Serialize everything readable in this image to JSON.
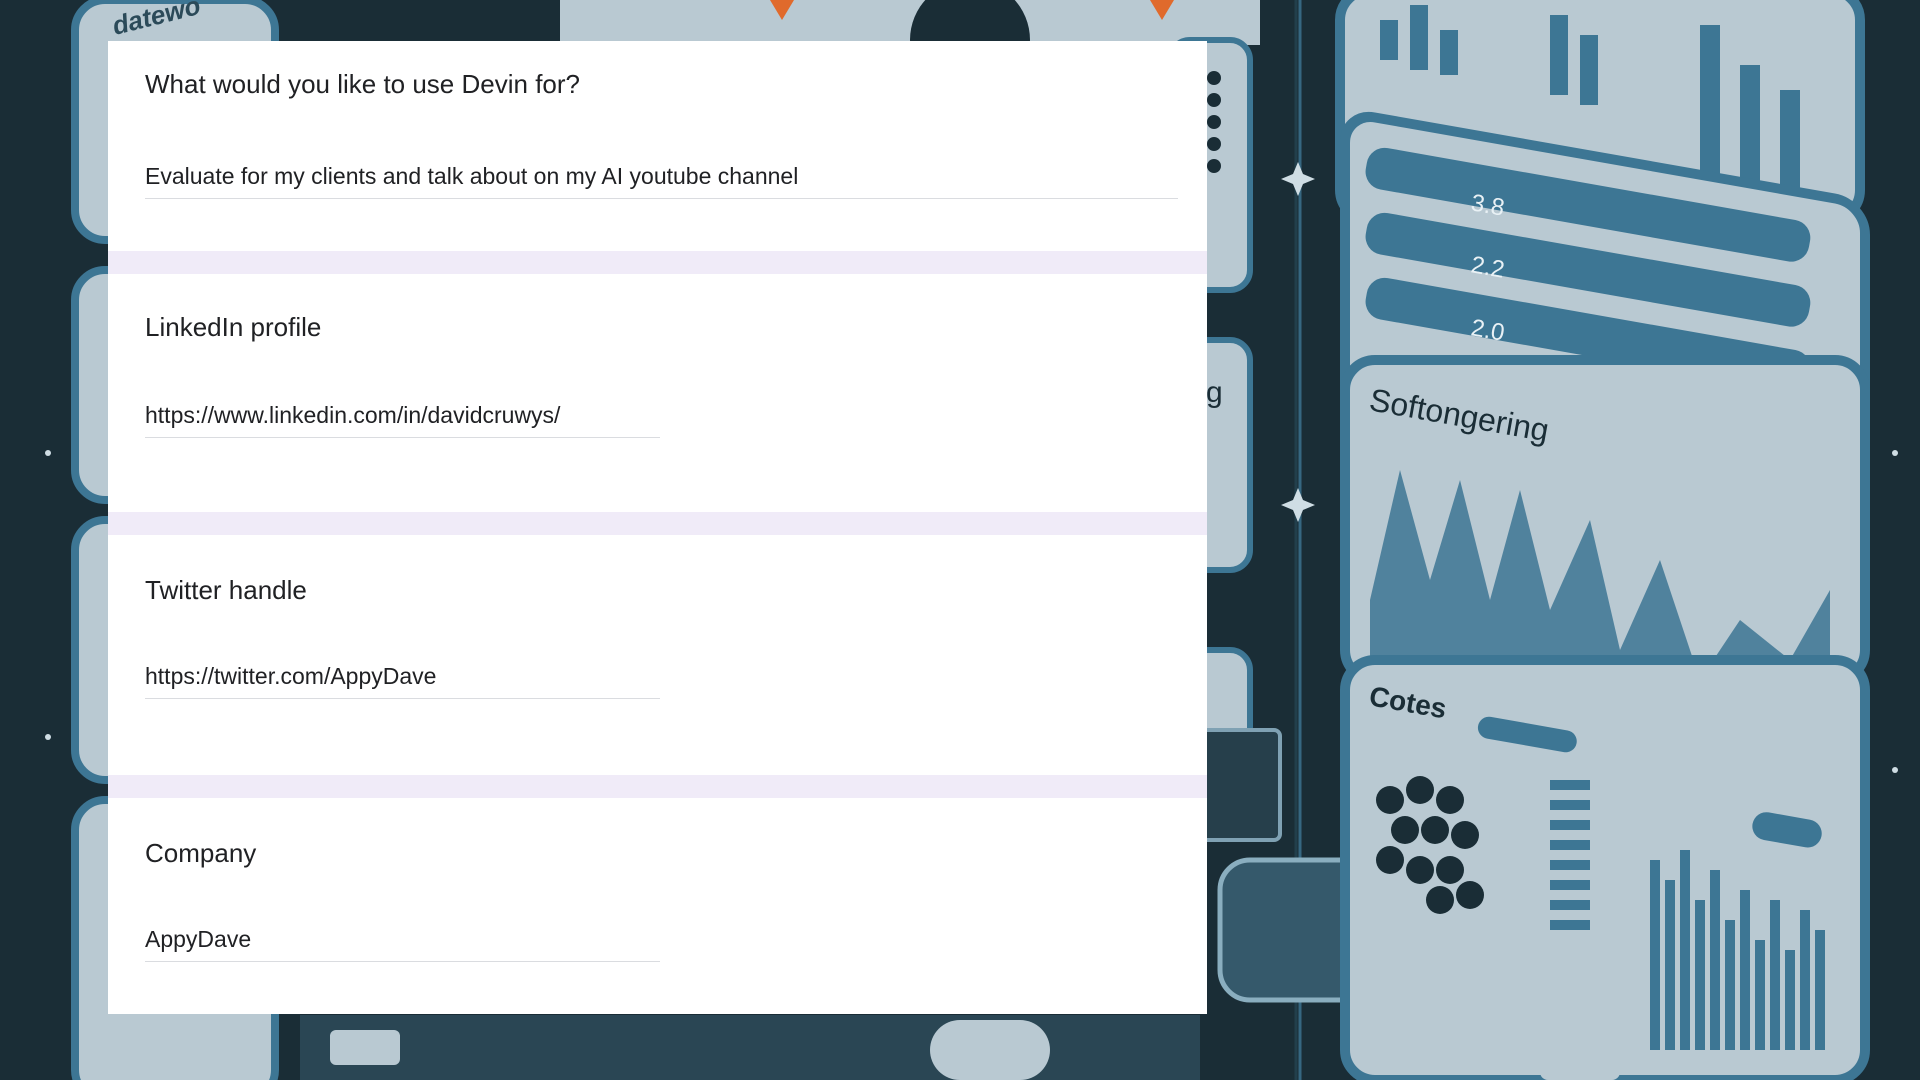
{
  "form": {
    "questions": [
      {
        "title": "What would you like to use Devin for?",
        "answer": "Evaluate for my clients and talk about on my AI youtube channel"
      },
      {
        "title": "LinkedIn profile",
        "answer": "https://www.linkedin.com/in/davidcruwys/"
      },
      {
        "title": "Twitter handle",
        "answer": "https://twitter.com/AppyDave"
      },
      {
        "title": "Company",
        "answer": "AppyDave"
      }
    ]
  },
  "background_art": {
    "labels": [
      "datewo",
      "3.8",
      "2.2",
      "2.0",
      "Softongering",
      "Cotes"
    ]
  },
  "colors": {
    "background_dark": "#1a2d36",
    "art_blue": "#3d7694",
    "art_light": "#b9c9d2",
    "form_band": "#f0ebf8",
    "card": "#ffffff"
  }
}
